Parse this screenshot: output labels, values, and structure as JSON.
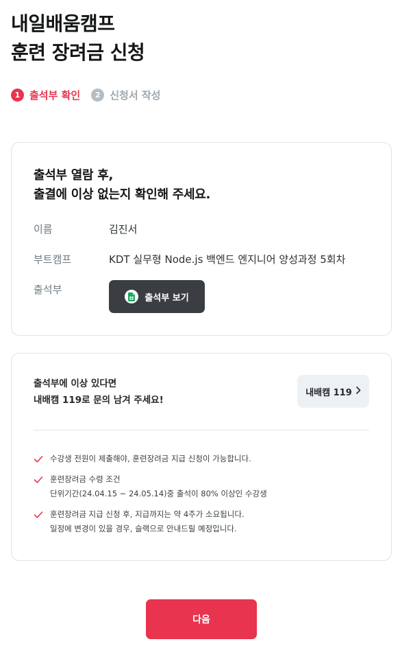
{
  "page": {
    "title_line1": "내일배움캠프",
    "title_line2": "훈련 장려금 신청"
  },
  "steps": [
    {
      "number": "1",
      "label": "출석부 확인",
      "state": "active"
    },
    {
      "number": "2",
      "label": "신청서 작성",
      "state": "inactive"
    }
  ],
  "attendance_card": {
    "heading_line1": "출석부 열람 후,",
    "heading_line2": "출결에 이상 없는지 확인해 주세요.",
    "rows": [
      {
        "label": "이름",
        "value": "김진서"
      },
      {
        "label": "부트캠프",
        "value": "KDT 실무형 Node.js 백엔드 엔지니어 양성과정 5회차"
      },
      {
        "label": "출석부",
        "value": ""
      }
    ],
    "view_button_label": "출석부 보기",
    "view_button_icon": "spreadsheet-doc-icon"
  },
  "help_card": {
    "text_line1": "출석부에 이상 있다면",
    "text_line2": "내배캠 119로 문의 남겨 주세요!",
    "help_button_label": "내배캠 119",
    "help_button_icon": "chevron-right-icon",
    "notes": [
      {
        "line1": "수강생 전원이 제출해야, 훈련장려금 지급 신청이 가능합니다.",
        "line2": ""
      },
      {
        "line1": "훈련장려금 수령 조건",
        "line2": "단위기간(24.04.15 ~ 24.05.14)중 출석이 80% 이상인 수강생"
      },
      {
        "line1": "훈련장려금 지급 신청 후, 지급까지는 약 4주가 소요됩니다.",
        "line2": "일정에 변경이 있을 경우, 슬랙으로 안내드릴 예정입니다."
      }
    ]
  },
  "footer": {
    "next_button_label": "다음"
  },
  "colors": {
    "accent": "#e8344e",
    "inactive_step": "#b4bcc4",
    "dark_button": "#3a3e42",
    "help_button_bg": "#eef1f3",
    "sheet_green": "#1fa463"
  }
}
